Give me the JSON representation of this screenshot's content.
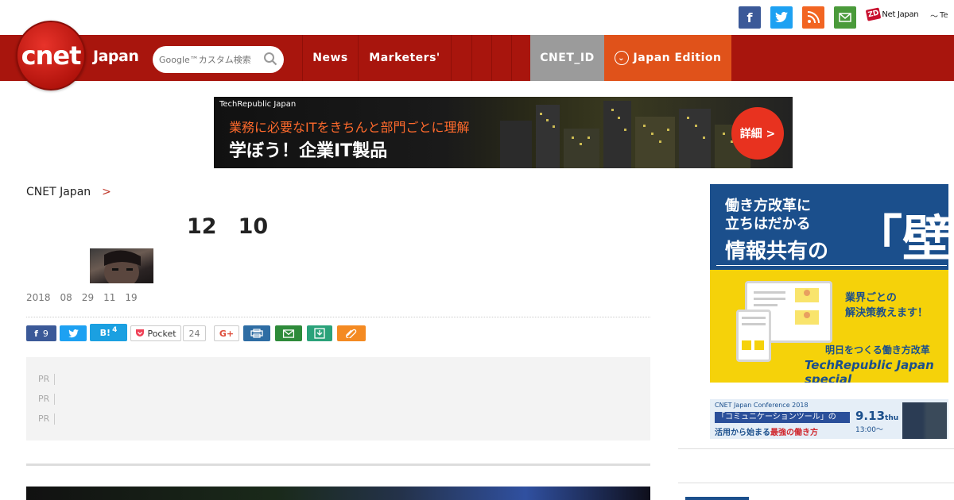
{
  "top": {
    "icons": [
      "facebook-icon",
      "twitter-icon",
      "rss-icon",
      "mail-icon"
    ],
    "zd_logo": "ZD",
    "zd_text": "Net Japan",
    "te_text": "Te"
  },
  "nav": {
    "logo_text": "cnet",
    "logo_japan": "Japan",
    "search_placeholder": "Google™カスタム検索",
    "items": [
      {
        "label": "News"
      },
      {
        "label": "Marketers'"
      },
      {
        "label": ""
      },
      {
        "label": ""
      },
      {
        "label": ""
      },
      {
        "label": ""
      }
    ],
    "cnet_id": "CNET_ID",
    "edition": "Japan Edition"
  },
  "banner": {
    "small": "TechRepublic Japan",
    "line1": "業務に必要なITをきちんと部門ごとに理解",
    "line2": "学ぼう！企業IT製品",
    "cta": "詳細 >"
  },
  "article": {
    "crumb_home": "CNET Japan",
    "crumb_sep": ">",
    "crumb_section": "",
    "title": "　12　10",
    "date": "2018　08　29　11　19　"
  },
  "share": {
    "fb_count": "9",
    "hb_label": "B!",
    "hb_count": "4",
    "pocket_label": "Pocket",
    "pocket_count": "24",
    "g_label": "G+"
  },
  "pr": {
    "tag": "PR",
    "items": [
      "",
      "",
      ""
    ]
  },
  "sidebar": {
    "ad1": {
      "line1": "働き方改革に",
      "line2": "立ちはだかる",
      "line3": "情報共有の",
      "wall": "「壁」",
      "y1": "業界ごとの",
      "y1b": "解決策教えます！",
      "y2": "明日をつくる働き方改革",
      "y3": "TechRepublic Japan special"
    },
    "ad2": {
      "t1": "CNET Japan Conference 2018",
      "t2": "「コミュニケーションツール」の",
      "t3a": "活用から始まる",
      "t3b": "最強の働き方",
      "date": "9.13",
      "dow": "thu",
      "time": "13:00〜"
    },
    "section_head": ""
  },
  "colors": {
    "nav_red": "#a8150d",
    "edition_orange": "#e0521a",
    "cnet_id_gray": "#9b9b9b",
    "accent": "#c0392b"
  }
}
